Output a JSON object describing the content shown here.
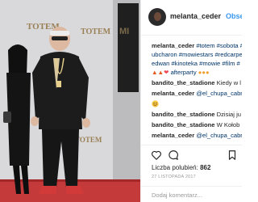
{
  "post": {
    "author": "melanta_ceder",
    "follow_label": "Obserwuj",
    "photo": {
      "banner_words": [
        "TOTEM",
        "TOTEM",
        "TOTEM"
      ]
    }
  },
  "comments": [
    {
      "user": "melanta_ceder",
      "text": "#totem #sobota #ubcharon #mowiestars #redcarpet #edwan #kinoteka #mowie #film #"
    },
    {
      "user": "",
      "text": "❤ afterparty"
    },
    {
      "user": "bandito_the_stadione",
      "text": "Kiedy w l"
    },
    {
      "user": "melanta_ceder",
      "text": "@el_chupa_cabra"
    },
    {
      "user": "bandito_the_stadione",
      "text": "Dzisiaj ju"
    },
    {
      "user": "bandito_the_stadione",
      "text": "W Kołob"
    },
    {
      "user": "melanta_ceder",
      "text": "@el_chupa_cabra"
    }
  ],
  "caption_lines": [
    "#totem #sobota #",
    "ubcharon #mowiestars #redcarpet",
    "edwan #kinoteka #mowie #film #"
  ],
  "emoji_line": {
    "prefix_icons": [
      "fire-icon",
      "fire-icon",
      "heart-icon"
    ],
    "text": "afterparty",
    "suffix_icons": [
      "hot-emoji-icon",
      "hot-emoji-icon",
      "hot-emoji-icon"
    ]
  },
  "footer": {
    "likes_label": "Liczba polubień:",
    "likes_count": "862",
    "date": "27 LISTOPADA 2017",
    "comment_placeholder": "Dodaj komentarz..."
  },
  "icons": {
    "like": "heart-outline-icon",
    "comment": "comment-bubble-icon",
    "save": "bookmark-icon",
    "smile": "smiley-icon"
  },
  "colors": {
    "link": "#3897f0",
    "hashtag": "#003569",
    "text": "#262626",
    "muted": "#999999"
  }
}
